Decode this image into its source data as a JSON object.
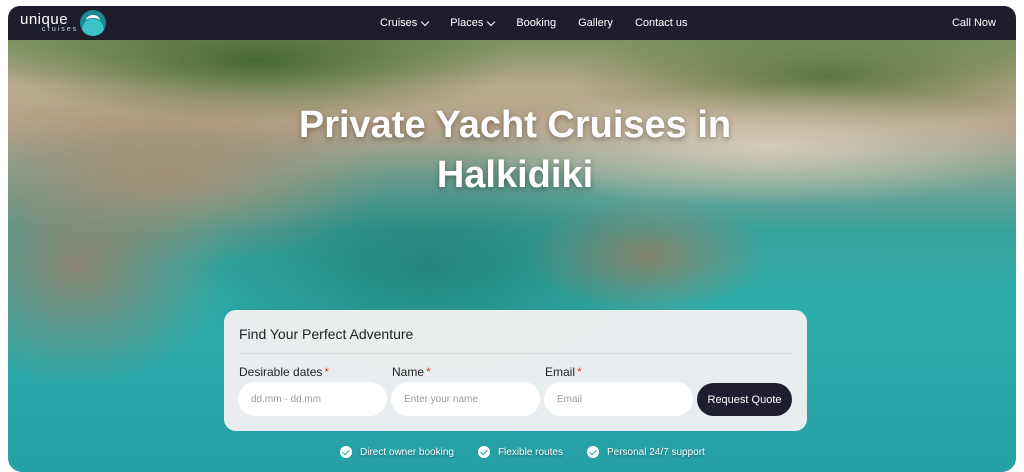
{
  "brand": {
    "name": "unique",
    "sub": "cruises",
    "logo_icon": "wave-logo-icon"
  },
  "nav": {
    "items": [
      {
        "label": "Cruises",
        "dropdown": true
      },
      {
        "label": "Places",
        "dropdown": true
      },
      {
        "label": "Booking",
        "dropdown": false
      },
      {
        "label": "Gallery",
        "dropdown": false
      },
      {
        "label": "Contact us",
        "dropdown": false
      }
    ],
    "call_label": "Call Now"
  },
  "hero": {
    "headline": "Private Yacht Cruises in Halkidiki"
  },
  "form": {
    "title": "Find Your Perfect Adventure",
    "dates": {
      "label": "Desirable dates",
      "required_mark": "*",
      "placeholder": "dd.mm - dd.mm"
    },
    "name": {
      "label": "Name",
      "required_mark": "*",
      "placeholder": "Enter your name"
    },
    "email": {
      "label": "Email",
      "required_mark": "*",
      "placeholder": "Email"
    },
    "submit_label": "Request Quote"
  },
  "features": [
    {
      "label": "Direct owner booking",
      "icon": "check-circle-icon"
    },
    {
      "label": "Flexible routes",
      "icon": "check-circle-icon"
    },
    {
      "label": "Personal 24/7 support",
      "icon": "check-circle-icon"
    }
  ],
  "colors": {
    "nav_bg": "#1e1d2b",
    "button_bg": "#1f1e2e",
    "required": "#e23b3b",
    "accent": "#2aa8a8"
  }
}
